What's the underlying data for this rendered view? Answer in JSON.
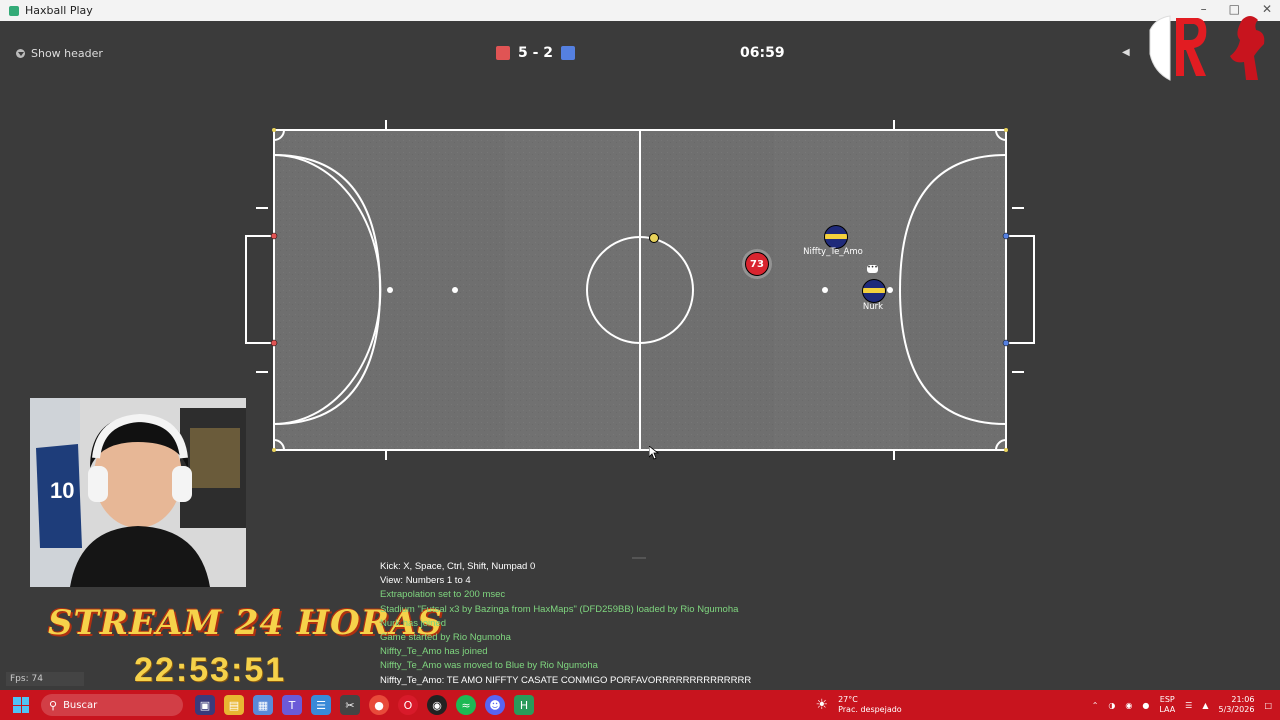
{
  "window": {
    "title": "Haxball Play"
  },
  "header": {
    "show_header_label": "Show header",
    "score": "5 - 2",
    "red_color": "#e05454",
    "blue_color": "#5580e0",
    "time": "06:59"
  },
  "players": [
    {
      "name": "Niffty_Te_Amo",
      "avatar": "",
      "team": "blue"
    },
    {
      "name": "Nurk",
      "avatar": "",
      "team": "blue"
    },
    {
      "name": "",
      "avatar": "73",
      "team": "red"
    }
  ],
  "fps_label": "Fps: 74",
  "overlay": {
    "stream_title": "STREAM 24 HORAS",
    "stream_clock": "22:53:51"
  },
  "chat": [
    {
      "text": "Kick: X, Space, Ctrl, Shift, Numpad 0",
      "color": "white"
    },
    {
      "text": "View: Numbers 1 to 4",
      "color": "white"
    },
    {
      "text": "Extrapolation set to 200 msec",
      "color": "green"
    },
    {
      "text": "Stadium \"Futsal x3 by Bazinga from HaxMaps\" (DFD259BB) loaded by Rio Ngumoha",
      "color": "green"
    },
    {
      "text": "Nurk has joined",
      "color": "green"
    },
    {
      "text": "Game started by Rio Ngumoha",
      "color": "green"
    },
    {
      "text": "Niffty_Te_Amo has joined",
      "color": "green"
    },
    {
      "text": "Niffty_Te_Amo was moved to Blue by Rio Ngumoha",
      "color": "green"
    },
    {
      "text": "Niffty_Te_Amo: TE AMO NIFFTY CASATE CONMIGO PORFAVORRRRRRRRRRRRRR",
      "color": "white"
    }
  ],
  "taskbar": {
    "search_placeholder": "Buscar",
    "weather_temp": "27°C",
    "weather_desc": "Prac. despejado",
    "lang1": "ESP",
    "lang2": "LAA",
    "time": "21:06",
    "date": "5/3/2026"
  }
}
